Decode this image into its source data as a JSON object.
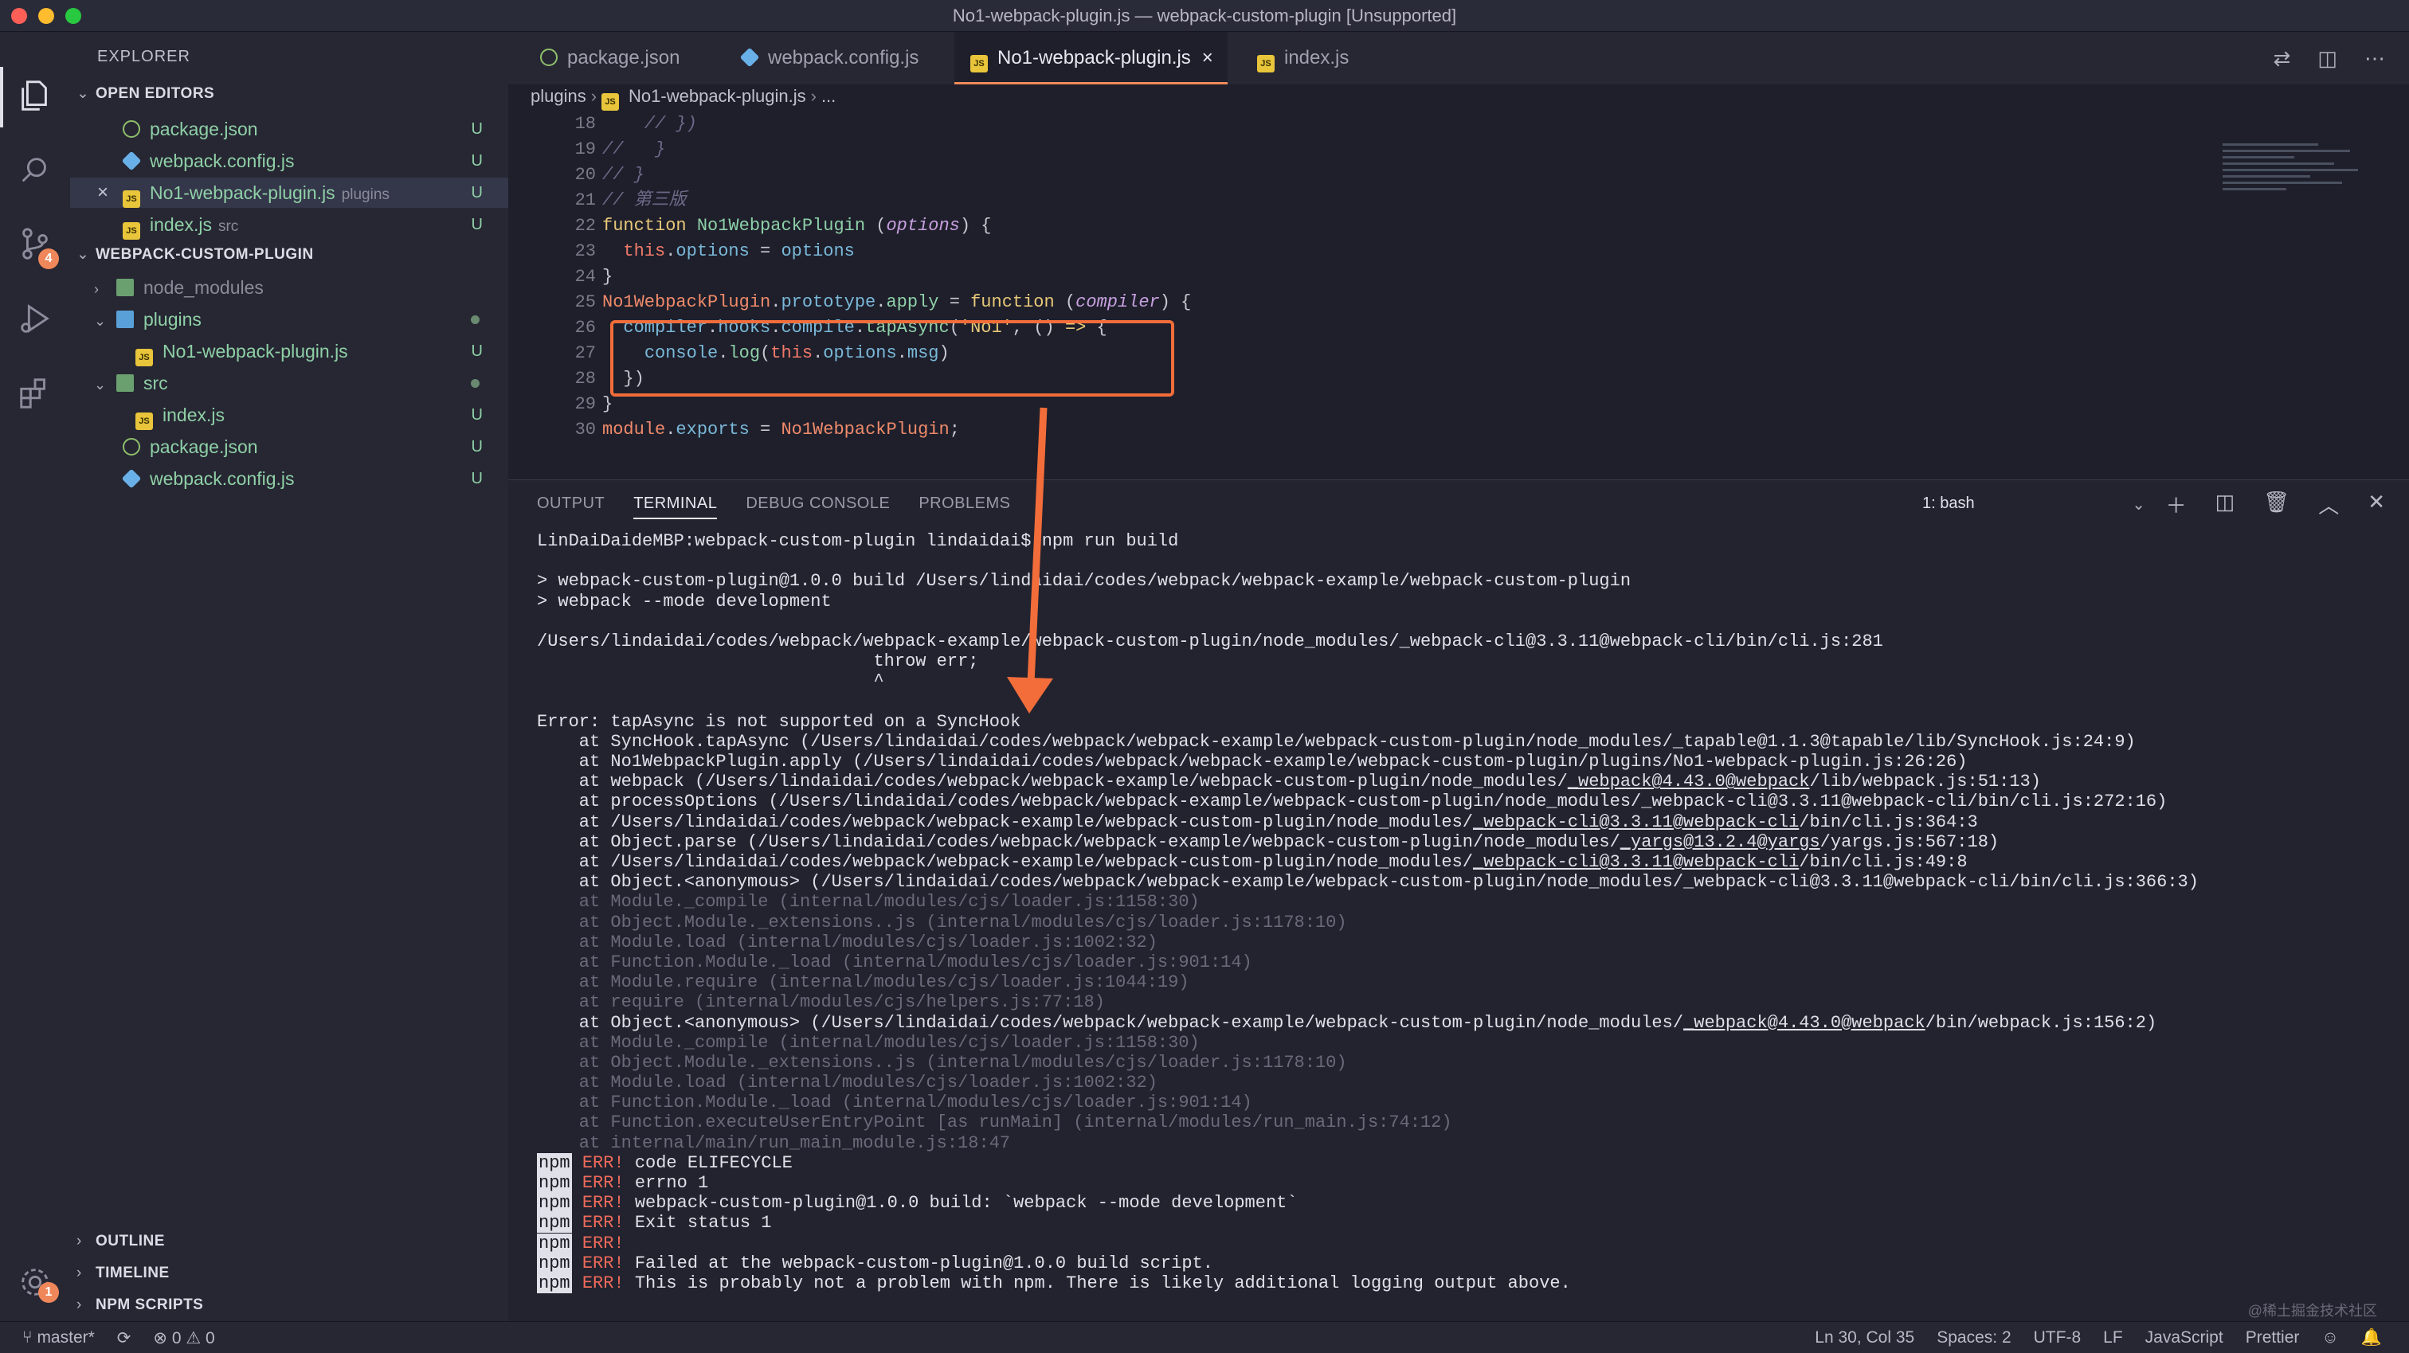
{
  "window": {
    "title": "No1-webpack-plugin.js — webpack-custom-plugin [Unsupported]"
  },
  "activity": {
    "scm_badge": "4",
    "settings_badge": "1"
  },
  "explorer": {
    "title": "EXPLORER",
    "open_editors_label": "OPEN EDITORS",
    "open_editors": [
      {
        "name": "package.json",
        "desc": "",
        "status": "U"
      },
      {
        "name": "webpack.config.js",
        "desc": "",
        "status": "U"
      },
      {
        "name": "No1-webpack-plugin.js",
        "desc": "plugins",
        "status": "U"
      },
      {
        "name": "index.js",
        "desc": "src",
        "status": "U"
      }
    ],
    "project_label": "WEBPACK-CUSTOM-PLUGIN",
    "tree": [
      {
        "name": "node_modules"
      },
      {
        "name": "plugins"
      },
      {
        "name": "No1-webpack-plugin.js",
        "status": "U"
      },
      {
        "name": "src"
      },
      {
        "name": "index.js",
        "status": "U"
      },
      {
        "name": "package.json",
        "status": "U"
      },
      {
        "name": "webpack.config.js",
        "status": "U"
      }
    ],
    "outline_label": "OUTLINE",
    "timeline_label": "TIMELINE",
    "npm_scripts_label": "NPM SCRIPTS"
  },
  "tabs": [
    {
      "label": "package.json"
    },
    {
      "label": "webpack.config.js"
    },
    {
      "label": "No1-webpack-plugin.js"
    },
    {
      "label": "index.js"
    }
  ],
  "breadcrumb": {
    "folder": "plugins",
    "file": "No1-webpack-plugin.js",
    "more": "..."
  },
  "code": {
    "line_numbers": [
      "18",
      "19",
      "20",
      "21",
      "22",
      "23",
      "24",
      "25",
      "26",
      "27",
      "28",
      "29",
      "30"
    ]
  },
  "panel": {
    "tabs": [
      "OUTPUT",
      "TERMINAL",
      "DEBUG CONSOLE",
      "PROBLEMS"
    ],
    "shell": "1: bash"
  },
  "terminal": {
    "prompt": "LinDaiDaideMBP:webpack-custom-plugin lindaidai$ npm run build",
    "l1": "> webpack-custom-plugin@1.0.0 build /Users/lindaidai/codes/webpack/webpack-example/webpack-custom-plugin",
    "l2": "> webpack --mode development",
    "l3": "/Users/lindaidai/codes/webpack/webpack-example/webpack-custom-plugin/node_modules/_webpack-cli@3.3.11@webpack-cli/bin/cli.js:281",
    "l4": "                                throw err;",
    "l5": "                                ^",
    "err_title": "Error: tapAsync is not supported on a SyncHook",
    "s1": "    at SyncHook.tapAsync (/Users/lindaidai/codes/webpack/webpack-example/webpack-custom-plugin/node_modules/_tapable@1.1.3@tapable/lib/SyncHook.js:24:9)",
    "s2": "    at No1WebpackPlugin.apply (/Users/lindaidai/codes/webpack/webpack-example/webpack-custom-plugin/plugins/No1-webpack-plugin.js:26:26)",
    "s3a": "    at webpack (/Users/lindaidai/codes/webpack/webpack-example/webpack-custom-plugin/node_modules/",
    "s3u": "_webpack@4.43.0@webpack",
    "s3b": "/lib/webpack.js:51:13)",
    "s4": "    at processOptions (/Users/lindaidai/codes/webpack/webpack-example/webpack-custom-plugin/node_modules/_webpack-cli@3.3.11@webpack-cli/bin/cli.js:272:16)",
    "s5a": "    at /Users/lindaidai/codes/webpack/webpack-example/webpack-custom-plugin/node_modules/",
    "s5u": "_webpack-cli@3.3.11@webpack-cli",
    "s5b": "/bin/cli.js:364:3",
    "s6a": "    at Object.parse (/Users/lindaidai/codes/webpack/webpack-example/webpack-custom-plugin/node_modules/",
    "s6u": "_yargs@13.2.4@yargs",
    "s6b": "/yargs.js:567:18)",
    "s7a": "    at /Users/lindaidai/codes/webpack/webpack-example/webpack-custom-plugin/node_modules/",
    "s7u": "_webpack-cli@3.3.11@webpack-cli",
    "s7b": "/bin/cli.js:49:8",
    "s8": "    at Object.<anonymous> (/Users/lindaidai/codes/webpack/webpack-example/webpack-custom-plugin/node_modules/_webpack-cli@3.3.11@webpack-cli/bin/cli.js:366:3)",
    "d1": "    at Module._compile (internal/modules/cjs/loader.js:1158:30)",
    "d2": "    at Object.Module._extensions..js (internal/modules/cjs/loader.js:1178:10)",
    "d3": "    at Module.load (internal/modules/cjs/loader.js:1002:32)",
    "d4": "    at Function.Module._load (internal/modules/cjs/loader.js:901:14)",
    "d5": "    at Module.require (internal/modules/cjs/loader.js:1044:19)",
    "d6": "    at require (internal/modules/cjs/helpers.js:77:18)",
    "s9a": "    at Object.<anonymous> (/Users/lindaidai/codes/webpack/webpack-example/webpack-custom-plugin/node_modules/",
    "s9u": "_webpack@4.43.0@webpack",
    "s9b": "/bin/webpack.js:156:2)",
    "e1": "    at Module._compile (internal/modules/cjs/loader.js:1158:30)",
    "e2": "    at Object.Module._extensions..js (internal/modules/cjs/loader.js:1178:10)",
    "e3": "    at Module.load (internal/modules/cjs/loader.js:1002:32)",
    "e4": "    at Function.Module._load (internal/modules/cjs/loader.js:901:14)",
    "e5": "    at Function.executeUserEntryPoint [as runMain] (internal/modules/run_main.js:74:12)",
    "e6": "    at internal/main/run_main_module.js:18:47",
    "npm_tag": "npm",
    "err_tag": "ERR!",
    "n1": " code ELIFECYCLE",
    "n2": " errno 1",
    "n3": " webpack-custom-plugin@1.0.0 build: `webpack --mode development`",
    "n4": " Exit status 1",
    "n5": "",
    "n6": " Failed at the webpack-custom-plugin@1.0.0 build script.",
    "n7": " This is probably not a problem with npm. There is likely additional logging output above."
  },
  "status": {
    "branch": "master*",
    "errors": "0",
    "warnings": "0",
    "position": "Ln 30, Col 35",
    "spaces": "Spaces: 2",
    "encoding": "UTF-8",
    "eol": "LF",
    "language": "JavaScript",
    "formatter": "Prettier"
  },
  "watermark": "@稀土掘金技术社区",
  "colors": {
    "accent": "#f26d3a",
    "untracked": "#8fd0a6",
    "background": "#1e1f2b"
  }
}
